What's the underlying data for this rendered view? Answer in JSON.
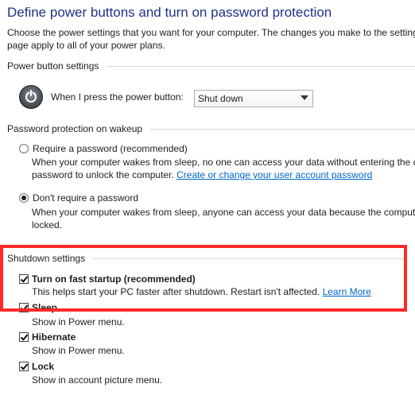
{
  "header": {
    "title": "Define power buttons and turn on password protection",
    "intro_line1": "Choose the power settings that you want for your computer. The changes you make to the settings",
    "intro_line2": "page apply to all of your power plans."
  },
  "power_button_settings": {
    "section_label": "Power button settings",
    "icon": "power-icon",
    "prompt": "When I press the power button:",
    "selected_action": "Shut down"
  },
  "password_protection": {
    "section_label": "Password protection on wakeup",
    "option_require": {
      "label": "Require a password (recommended)",
      "desc_line1": "When your computer wakes from sleep, no one can access your data without entering the c",
      "desc_line2_prefix": "password to unlock the computer. ",
      "link": "Create or change your user account password",
      "selected": false
    },
    "option_dont_require": {
      "label": "Don't require a password",
      "desc_line1": "When your computer wakes from sleep, anyone can access your data because the computer",
      "desc_line2": "locked.",
      "selected": true
    }
  },
  "shutdown_settings": {
    "section_label": "Shutdown settings",
    "items": [
      {
        "label": "Turn on fast startup (recommended)",
        "desc": "This helps start your PC faster after shutdown. Restart isn't affected. ",
        "link": "Learn More",
        "checked": true
      },
      {
        "label": "Sleep",
        "desc": "Show in Power menu.",
        "checked": true
      },
      {
        "label": "Hibernate",
        "desc": "Show in Power menu.",
        "checked": true
      },
      {
        "label": "Lock",
        "desc": "Show in account picture menu.",
        "checked": true
      }
    ]
  },
  "colors": {
    "title": "#1e3287",
    "link": "#0066cc",
    "highlight_border": "#ff2a2a",
    "section_rule": "#d9d9d9"
  }
}
